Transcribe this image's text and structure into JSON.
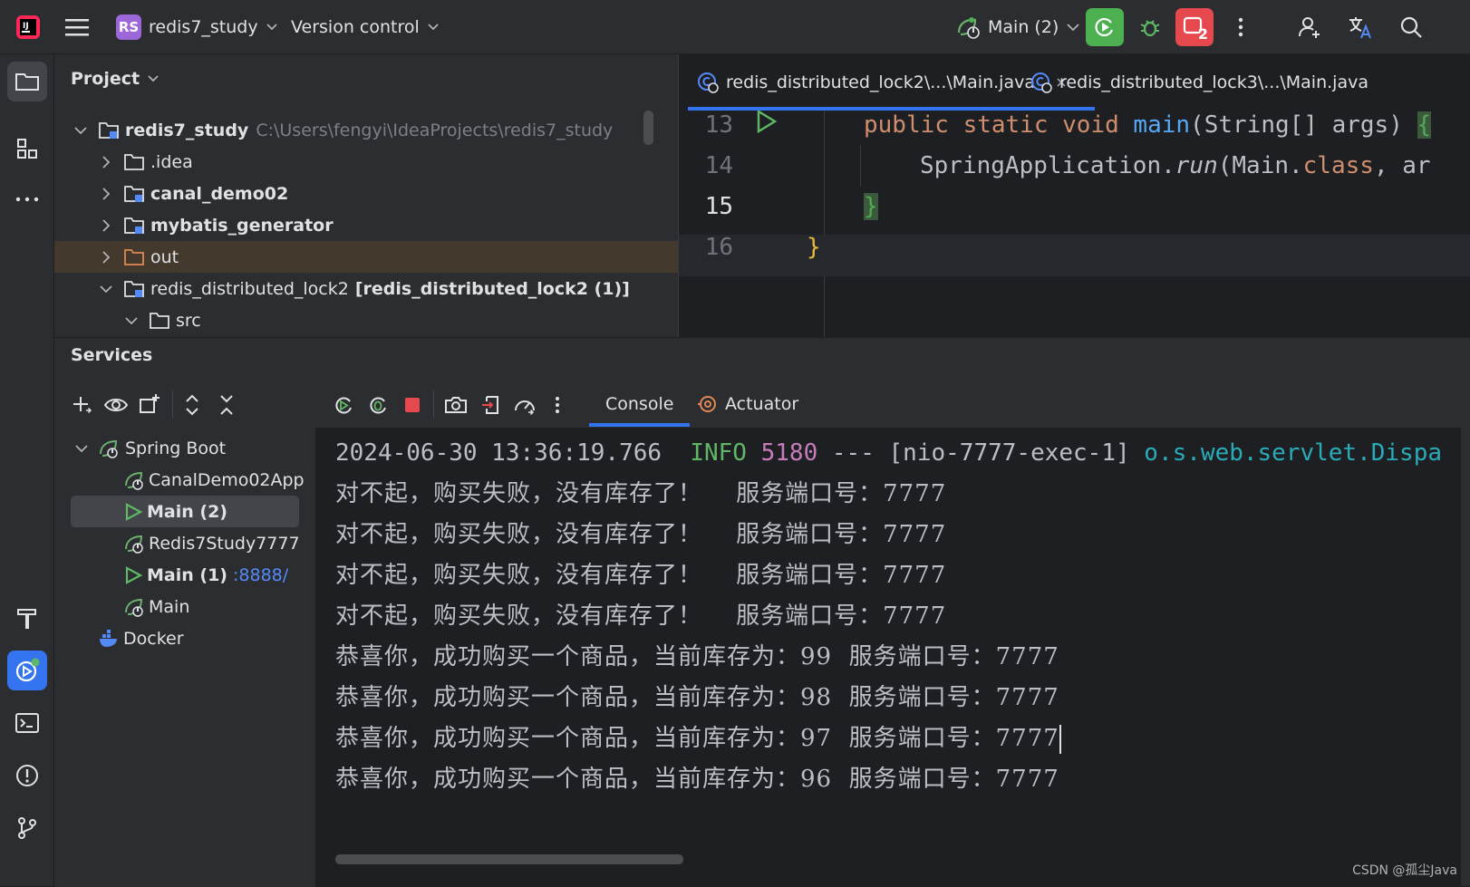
{
  "topbar": {
    "project_badge": "RS",
    "project_name": "redis7_study",
    "vcs_label": "Version control",
    "run_config": "Main (2)",
    "stop_badge": "2",
    "colors": {
      "run": "#4caf50",
      "stop": "#e5484d",
      "badge": "#9c67d8"
    }
  },
  "project_panel": {
    "title": "Project",
    "tree": [
      {
        "name": "redis7_study",
        "path": "C:\\Users\\fengyi\\IdeaProjects\\redis7_study"
      },
      {
        "name": ".idea"
      },
      {
        "name": "canal_demo02"
      },
      {
        "name": "mybatis_generator"
      },
      {
        "name": "out"
      },
      {
        "name": "redis_distributed_lock2",
        "module": "[redis_distributed_lock2 (1)]"
      },
      {
        "name": "src"
      }
    ]
  },
  "editor": {
    "tabs": [
      {
        "label": "redis_distributed_lock2\\...\\Main.java",
        "active": true
      },
      {
        "label": "redis_distributed_lock3\\...\\Main.java",
        "active": false
      }
    ],
    "line_numbers": [
      "13",
      "14",
      "15",
      "16"
    ],
    "code": {
      "l13_kw": "public static void ",
      "l13_fn": "main",
      "l13_rest": "(String[] args) ",
      "l13_brace": "{",
      "l14_a": "SpringApplication.",
      "l14_run": "run",
      "l14_b": "(Main.",
      "l14_class": "class",
      "l14_c": ", ar",
      "l15_brace": "}",
      "l16_brace": "}"
    }
  },
  "services": {
    "title": "Services",
    "tree": [
      {
        "label": "Spring Boot"
      },
      {
        "label": "CanalDemo02App"
      },
      {
        "label": "Main (2)",
        "selected": true
      },
      {
        "label": "Redis7Study7777"
      },
      {
        "label": "Main (1)",
        "port": ":8888/"
      },
      {
        "label": "Main"
      },
      {
        "label": "Docker"
      }
    ],
    "console_tabs": [
      "Console",
      "Actuator"
    ],
    "log_header": {
      "timestamp": "2024-06-30 13:36:19.766",
      "level": "INFO",
      "pid": "5180",
      "sep": "---",
      "thread": "[nio-7777-exec-1]",
      "logger": "o.s.web.servlet.Dispa"
    },
    "log_lines": [
      {
        "msg": "对不起，购买失败，没有库存了！",
        "port_label": "服务端口号：",
        "port": "7777"
      },
      {
        "msg": "对不起，购买失败，没有库存了！",
        "port_label": "服务端口号：",
        "port": "7777"
      },
      {
        "msg": "对不起，购买失败，没有库存了！",
        "port_label": "服务端口号：",
        "port": "7777"
      },
      {
        "msg": "对不起，购买失败，没有库存了！",
        "port_label": "服务端口号：",
        "port": "7777"
      },
      {
        "msg": "恭喜你，成功购买一个商品，当前库存为：99",
        "port_label": "服务端口号：",
        "port": "7777"
      },
      {
        "msg": "恭喜你，成功购买一个商品，当前库存为：98",
        "port_label": "服务端口号：",
        "port": "7777"
      },
      {
        "msg": "恭喜你，成功购买一个商品，当前库存为：97",
        "port_label": "服务端口号：",
        "port": "7777"
      },
      {
        "msg": "恭喜你，成功购买一个商品，当前库存为：96",
        "port_label": "服务端口号：",
        "port": "7777"
      }
    ]
  },
  "watermark": "CSDN @孤尘Java"
}
